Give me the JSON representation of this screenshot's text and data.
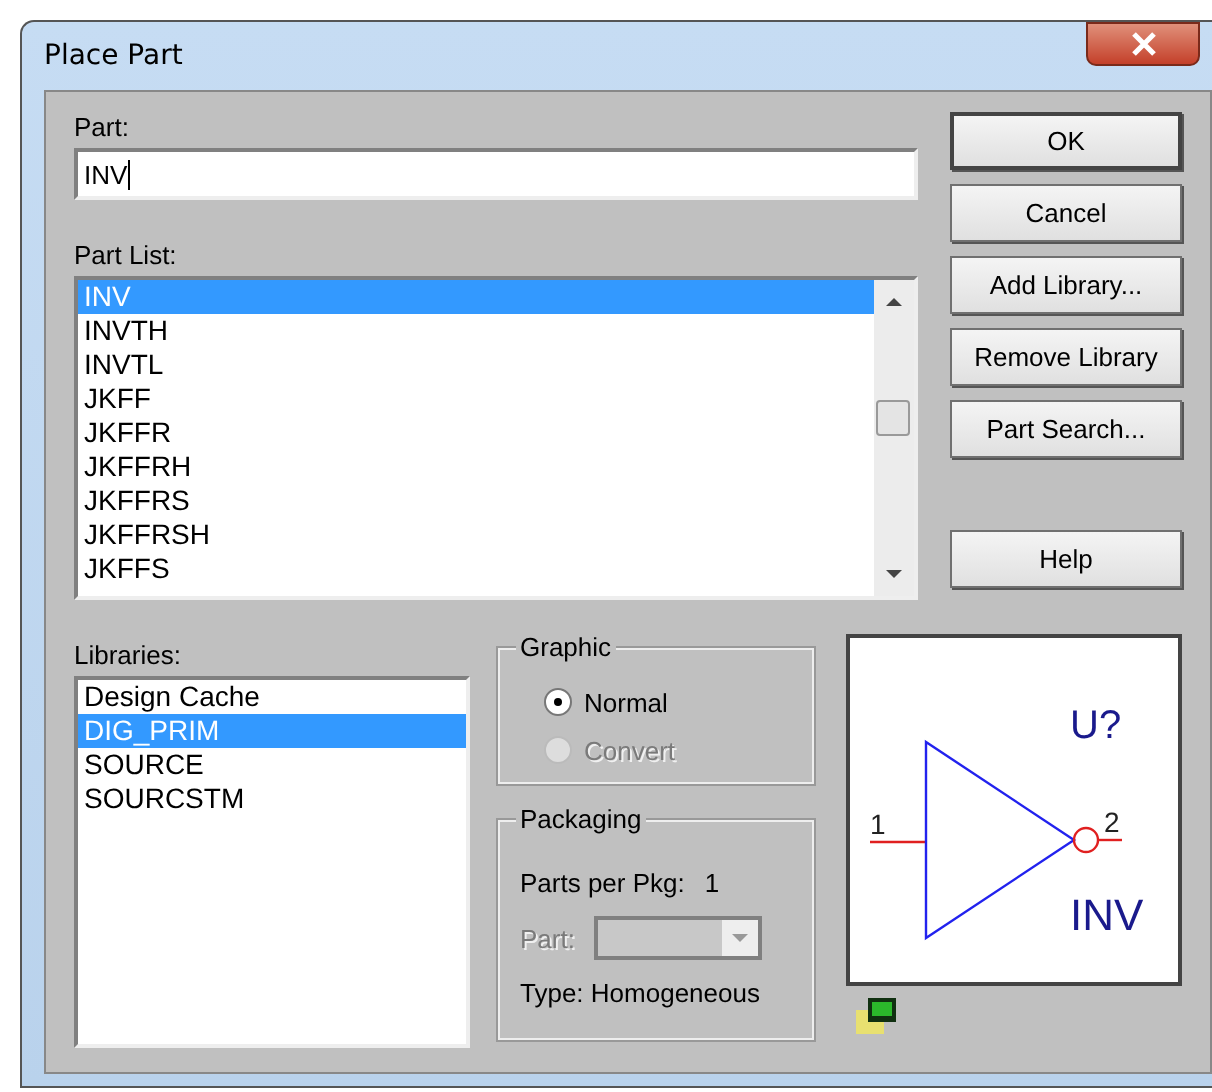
{
  "window": {
    "title": "Place Part"
  },
  "part": {
    "label": "Part:",
    "value": "INV"
  },
  "part_list": {
    "label": "Part List:",
    "items": [
      {
        "name": "INV",
        "selected": true
      },
      {
        "name": "INVTH",
        "selected": false
      },
      {
        "name": "INVTL",
        "selected": false
      },
      {
        "name": "JKFF",
        "selected": false
      },
      {
        "name": "JKFFR",
        "selected": false
      },
      {
        "name": "JKFFRH",
        "selected": false
      },
      {
        "name": "JKFFRS",
        "selected": false
      },
      {
        "name": "JKFFRSH",
        "selected": false
      },
      {
        "name": "JKFFS",
        "selected": false
      }
    ]
  },
  "libraries": {
    "label": "Libraries:",
    "items": [
      {
        "name": "Design Cache",
        "selected": false
      },
      {
        "name": "DIG_PRIM",
        "selected": true
      },
      {
        "name": "SOURCE",
        "selected": false
      },
      {
        "name": "SOURCSTM",
        "selected": false
      }
    ]
  },
  "graphic": {
    "title": "Graphic",
    "options": [
      {
        "label": "Normal",
        "selected": true,
        "disabled": false
      },
      {
        "label": "Convert",
        "selected": false,
        "disabled": true
      }
    ]
  },
  "packaging": {
    "title": "Packaging",
    "parts_per_pkg_label": "Parts per Pkg:",
    "parts_per_pkg": "1",
    "part_label": "Part:",
    "part_disabled": true,
    "type": "Type:  Homogeneous"
  },
  "preview": {
    "reference": "U?",
    "value": "INV",
    "pin_in": "1",
    "pin_out": "2"
  },
  "buttons": [
    {
      "label": "OK",
      "kind": "primary"
    },
    {
      "label": "Cancel",
      "kind": "normal"
    },
    {
      "label": "Add Library...",
      "kind": "normal"
    },
    {
      "label": "Remove Library",
      "kind": "normal"
    },
    {
      "label": "Part Search...",
      "kind": "normal"
    },
    {
      "label": "Help",
      "kind": "spaced"
    }
  ]
}
